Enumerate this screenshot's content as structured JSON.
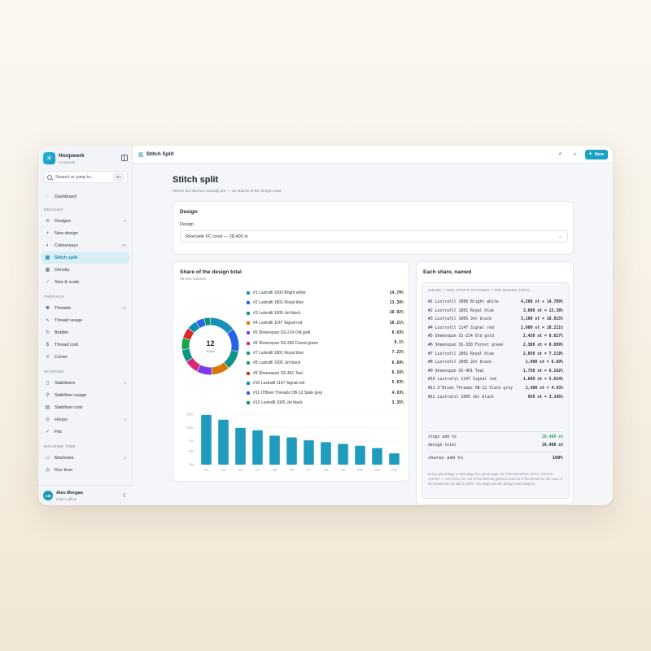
{
  "app": {
    "name": "Hoopwork",
    "workspace": "Hoopwork",
    "logo_icon": "needle-logo-icon"
  },
  "search": {
    "placeholder": "Search or jump to...",
    "shortcut": "⌘K"
  },
  "nav": {
    "dashboard": "Dashboard",
    "sections": [
      {
        "title": "DESIGNS",
        "items": [
          {
            "label": "Designs",
            "count": "8",
            "icon": "layers-icon"
          },
          {
            "label": "New design",
            "count": "",
            "icon": "plus-icon"
          },
          {
            "label": "Colourways",
            "count": "29",
            "icon": "palette-icon"
          },
          {
            "label": "Stitch split",
            "count": "",
            "icon": "bar-chart-icon",
            "active": true
          },
          {
            "label": "Density",
            "count": "",
            "icon": "grid-icon"
          },
          {
            "label": "Size & scale",
            "count": "",
            "icon": "ruler-icon"
          }
        ]
      },
      {
        "title": "THREADS",
        "items": [
          {
            "label": "Threads",
            "count": "10",
            "icon": "spool-icon"
          },
          {
            "label": "Thread usage",
            "count": "",
            "icon": "activity-icon"
          },
          {
            "label": "Bobbin",
            "count": "",
            "icon": "refresh-icon"
          },
          {
            "label": "Thread cost",
            "count": "",
            "icon": "dollar-icon"
          },
          {
            "label": "Cones",
            "count": "",
            "icon": "cone-icon"
          }
        ]
      },
      {
        "title": "HOOPING",
        "items": [
          {
            "label": "Stabilisers",
            "count": "5",
            "icon": "file-icon"
          },
          {
            "label": "Stabiliser usage",
            "count": "",
            "icon": "wand-icon"
          },
          {
            "label": "Stabiliser cost",
            "count": "",
            "icon": "receipt-icon"
          },
          {
            "label": "Hoops",
            "count": "6",
            "icon": "target-icon"
          },
          {
            "label": "Fits",
            "count": "",
            "icon": "check-icon"
          }
        ]
      },
      {
        "title": "MACHINE TIME",
        "items": [
          {
            "label": "Machines",
            "count": "3",
            "icon": "printer-icon"
          },
          {
            "label": "Run time",
            "count": "",
            "icon": "clock-icon"
          }
        ]
      }
    ]
  },
  "user": {
    "initials": "AM",
    "name": "Alex Morgan",
    "status": "USD • offline"
  },
  "topbar": {
    "title": "Stitch Split",
    "new_label": "New"
  },
  "page": {
    "title": "Stitch split",
    "subtitle": "Where the stitches actually are — as shares of the design total"
  },
  "design_card": {
    "title": "Design",
    "field_label": "Design",
    "selected": "Riverside FC crest — 28,400 st"
  },
  "share_card": {
    "title": "Share of the design total",
    "subtitle": "28,400 stitches",
    "donut_center_value": "12",
    "donut_center_label": "stops"
  },
  "chart_data": {
    "type": "bar",
    "title": "",
    "categories": [
      "#1",
      "#2",
      "#3",
      "#4",
      "#5",
      "#6",
      "#7",
      "#8",
      "#9",
      "#10",
      "#11",
      "#12"
    ],
    "values": [
      14.79,
      13.38,
      10.92,
      10.21,
      8.63,
      8.1,
      7.22,
      6.69,
      6.16,
      5.63,
      4.93,
      3.35
    ],
    "ylim": [
      0,
      15
    ],
    "yticks": [
      "15%",
      "11%",
      "7%",
      "4%",
      "0%"
    ],
    "ytick_values": [
      15,
      11,
      7,
      4,
      0
    ],
    "grid": true,
    "bar_color": "#1f9cbd",
    "donut": {
      "labels": [
        "#1 Lustrafil 1000 Bright white",
        "#2 Lustrafil 1801 Royal blue",
        "#3 Lustrafil 1005 Jet black",
        "#4 Lustrafil 1147 Signal red",
        "#5 Sheenspun SS-214 Old gold",
        "#6 Sheenspun SS-330 Forest green",
        "#7 Lustrafil 1801 Royal blue",
        "#8 Lustrafil 1005 Jet black",
        "#9 Sheenspun SS-461 Teal",
        "#10 Lustrafil 1147 Signal red",
        "#11 O'Brien Threads OB-12 Slate grey",
        "#12 Lustrafil 1005 Jet black"
      ],
      "value_labels": [
        "14.79%",
        "13.38%",
        "10.92%",
        "10.21%",
        "8.63%",
        "8.1%",
        "7.22%",
        "6.69%",
        "6.16%",
        "5.63%",
        "4.93%",
        "3.35%"
      ],
      "values": [
        14.79,
        13.38,
        10.92,
        10.21,
        8.63,
        8.1,
        7.22,
        6.69,
        6.16,
        5.63,
        4.93,
        3.35
      ],
      "colors": [
        "#1a8fb8",
        "#2563eb",
        "#0f9488",
        "#d97706",
        "#7c3aed",
        "#db2777",
        "#0d9488",
        "#16a34a",
        "#dc2626",
        "#0891b2",
        "#2563eb",
        "#059669"
      ]
    }
  },
  "named_card": {
    "title": "Each share, named",
    "header": "SHARE = THIS STOP'S STITCHES ÷ THE DESIGN TOTAL",
    "rows": [
      {
        "name": "#1 Lustrafil 1000 Bright white",
        "calc": "4,200 st ÷ 14.789%"
      },
      {
        "name": "#2 Lustrafil 1801 Royal blue",
        "calc": "3,800 st = 13.38%"
      },
      {
        "name": "#3 Lustrafil 1005 Jet black",
        "calc": "3,100 st = 10.915%"
      },
      {
        "name": "#4 Lustrafil 1147 Signal red",
        "calc": "2,900 st = 10.211%"
      },
      {
        "name": "#5 Sheenspun SS-214 Old gold",
        "calc": "2,450 st = 8.627%"
      },
      {
        "name": "#6 Sheenspun SS-330 Forest green",
        "calc": "2,300 st = 8.099%"
      },
      {
        "name": "#7 Lustrafil 1801 Royal blue",
        "calc": "2,050 st = 7.218%"
      },
      {
        "name": "#8 Lustrafil 1005 Jet black",
        "calc": "1,900 st = 6.69%"
      },
      {
        "name": "#9 Sheenspun SS-461 Teal",
        "calc": "1,750 st = 6.162%"
      },
      {
        "name": "#10 Lustrafil 1147 Signal red",
        "calc": "1,600 st = 5.634%"
      },
      {
        "name": "#11 O'Brien Threads OB-12 Slate grey",
        "calc": "1,400 st = 4.93%"
      },
      {
        "name": "#12 Lustrafil 1005 Jet black",
        "calc": "950 st = 3.345%"
      }
    ],
    "stops_add_to_label": "stops add to",
    "stops_add_to_value": "28,400 st",
    "design_total_label": "design total",
    "design_total_value": "28,400 st",
    "shares_add_to_label": "shares add to",
    "shares_add_to_value": "100%",
    "note": "Every percentage on this page is a percentage OF THE DESIGN'S TOTAL STITCH COUNT — not of the run, not of the finished garment and not of the thread on the cone. If the shares do not add to 100%, the stops and the design total disagree."
  }
}
